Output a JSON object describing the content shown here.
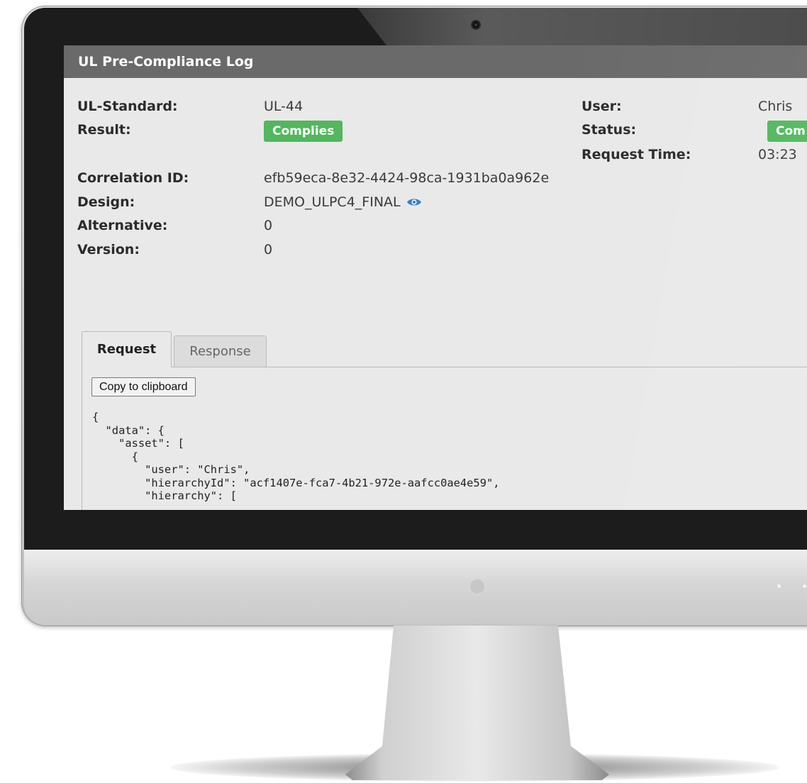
{
  "app": {
    "title": "UL Pre-Compliance Log"
  },
  "fields": {
    "ul_standard": {
      "label": "UL-Standard:",
      "value": "UL-44"
    },
    "result": {
      "label": "Result:",
      "value": "Complies"
    },
    "user": {
      "label": "User:",
      "value": "Chris"
    },
    "status": {
      "label": "Status:",
      "value": "Com"
    },
    "request_time": {
      "label": "Request Time:",
      "value": "03:23"
    },
    "correlation_id": {
      "label": "Correlation ID:",
      "value": "efb59eca-8e32-4424-98ca-1931ba0a962e"
    },
    "design": {
      "label": "Design:",
      "value": "DEMO_ULPC4_FINAL"
    },
    "alternative": {
      "label": "Alternative:",
      "value": "0"
    },
    "version": {
      "label": "Version:",
      "value": "0"
    }
  },
  "tabs": [
    {
      "label": "Request",
      "active": true
    },
    {
      "label": "Response",
      "active": false
    }
  ],
  "actions": {
    "copy_label": "Copy to clipboard"
  },
  "request_json": "{\n  \"data\": {\n    \"asset\": [\n      {\n        \"user\": \"Chris\",\n        \"hierarchyId\": \"acf1407e-fca7-4b21-972e-aafcc0ae4e59\",\n        \"hierarchy\": [",
  "colors": {
    "titlebar": "#6a6a6a",
    "badge_success": "#52b75d",
    "screen_background": "#e9e9e9",
    "eye_icon": "#2f7fd0"
  },
  "icons": {
    "design_view": "eye-icon"
  }
}
